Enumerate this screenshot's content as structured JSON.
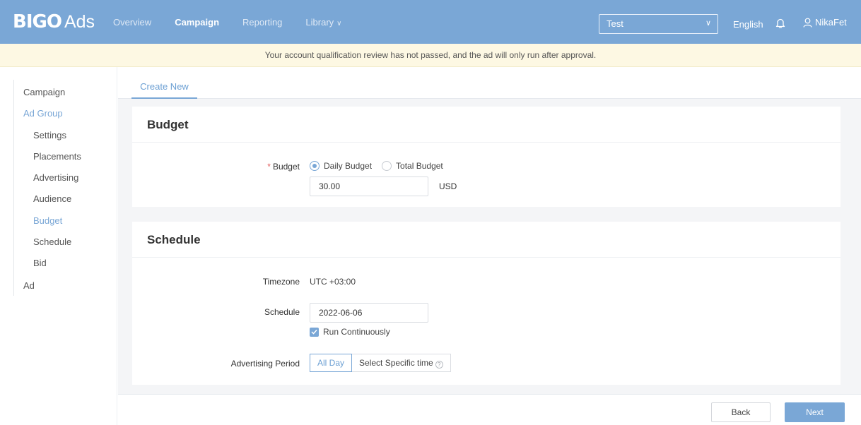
{
  "header": {
    "logo_bold": "BIGO",
    "logo_light": "Ads",
    "nav": [
      {
        "label": "Overview",
        "active": false
      },
      {
        "label": "Campaign",
        "active": true
      },
      {
        "label": "Reporting",
        "active": false
      },
      {
        "label": "Library",
        "active": false
      }
    ],
    "account_select": "Test",
    "language": "English",
    "username": "NikaFet"
  },
  "notice": "Your account qualification review has not passed, and the ad will only run after approval.",
  "sidebar": {
    "items": [
      {
        "label": "Campaign"
      },
      {
        "label": "Ad Group"
      },
      {
        "label": "Settings"
      },
      {
        "label": "Placements"
      },
      {
        "label": "Advertising"
      },
      {
        "label": "Audience"
      },
      {
        "label": "Budget"
      },
      {
        "label": "Schedule"
      },
      {
        "label": "Bid"
      },
      {
        "label": "Ad"
      }
    ]
  },
  "tabs": {
    "create_new": "Create New"
  },
  "budget": {
    "title": "Budget",
    "label": "Budget",
    "options": [
      "Daily Budget",
      "Total Budget"
    ],
    "selected": "Daily Budget",
    "amount": "30.00",
    "currency": "USD"
  },
  "schedule": {
    "title": "Schedule",
    "timezone_label": "Timezone",
    "timezone_value": "UTC +03:00",
    "schedule_label": "Schedule",
    "schedule_date": "2022-06-06",
    "run_continuously": "Run Continuously",
    "period_label": "Advertising Period",
    "period_options": [
      "All Day",
      "Select Specific time"
    ]
  },
  "footer": {
    "back": "Back",
    "next": "Next"
  },
  "colors": {
    "header_bg": "#7aa7d6",
    "accent": "#7aa7d6",
    "notice_bg": "#fdf8e3",
    "required": "#e25b5b"
  }
}
